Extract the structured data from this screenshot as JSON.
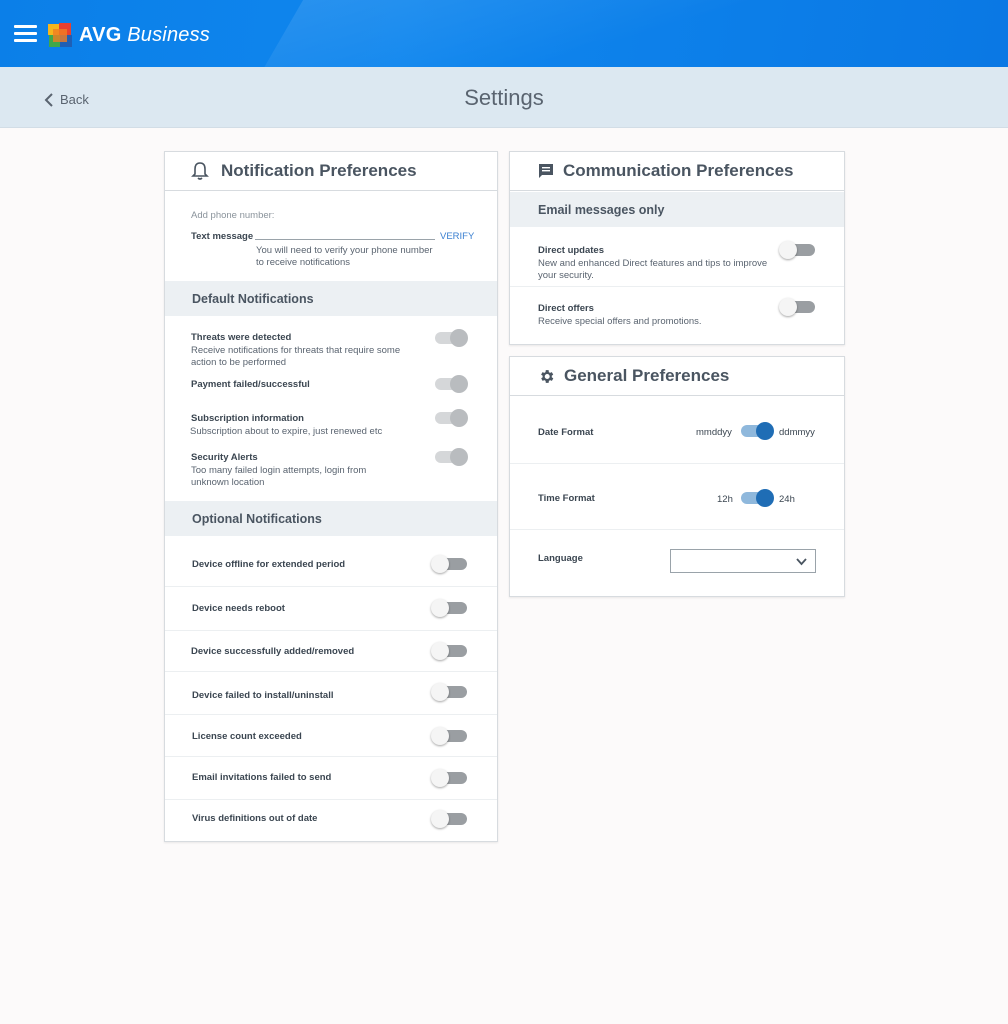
{
  "app": {
    "brand_bold": "AVG",
    "brand_italic": "Business"
  },
  "header": {
    "back_label": "Back",
    "title": "Settings"
  },
  "notification_prefs": {
    "title": "Notification Preferences",
    "phone_hint": "Add phone number:",
    "text_message_label": "Text message",
    "verify_label": "VERIFY",
    "verify_note_line1": "You will need to verify your phone number",
    "verify_note_line2": "to receive notifications",
    "default_section": "Default Notifications",
    "defaults": [
      {
        "title": "Threats were detected",
        "desc1": "Receive notifications for threats that require some",
        "desc2": "action to be performed",
        "state": "on-disabled"
      },
      {
        "title": "Payment failed/successful",
        "desc1": "",
        "desc2": "",
        "state": "on-disabled"
      },
      {
        "title": "Subscription information",
        "desc1": "Subscription about to expire, just renewed etc",
        "desc2": "",
        "state": "on-disabled"
      },
      {
        "title": "Security Alerts",
        "desc1": "Too many failed login attempts, login from",
        "desc2": "unknown location",
        "state": "on-disabled"
      }
    ],
    "optional_section": "Optional Notifications",
    "optional": [
      {
        "title": "Device offline for extended period",
        "state": "off"
      },
      {
        "title": "Device needs reboot",
        "state": "off"
      },
      {
        "title": "Device successfully added/removed",
        "state": "off"
      },
      {
        "title": "Device failed to install/uninstall",
        "state": "off"
      },
      {
        "title": "License count exceeded",
        "state": "off"
      },
      {
        "title": "Email invitations failed to send",
        "state": "off"
      },
      {
        "title": "Virus definitions out of date",
        "state": "off"
      }
    ]
  },
  "communication_prefs": {
    "title": "Communication Preferences",
    "section": "Email messages only",
    "items": [
      {
        "title": "Direct updates",
        "desc1": "New and enhanced Direct features and tips to improve",
        "desc2": "your security.",
        "state": "off"
      },
      {
        "title": "Direct offers",
        "desc1": "Receive special offers and promotions.",
        "desc2": "",
        "state": "off"
      }
    ]
  },
  "general_prefs": {
    "title": "General Preferences",
    "date_format": {
      "label": "Date Format",
      "left": "mmddyy",
      "right": "ddmmyy",
      "selected": "ddmmyy"
    },
    "time_format": {
      "label": "Time Format",
      "left": "12h",
      "right": "24h",
      "selected": "24h"
    },
    "language": {
      "label": "Language",
      "value": ""
    }
  },
  "colors": {
    "topbar": "#0b7fe8",
    "accent_blue": "#1f6db5",
    "verify_link": "#3a7fd0"
  },
  "icons": [
    "menu-icon",
    "avg-logo-icon",
    "chevron-left-icon",
    "bell-icon",
    "message-icon",
    "gear-icon",
    "chevron-down-icon"
  ]
}
